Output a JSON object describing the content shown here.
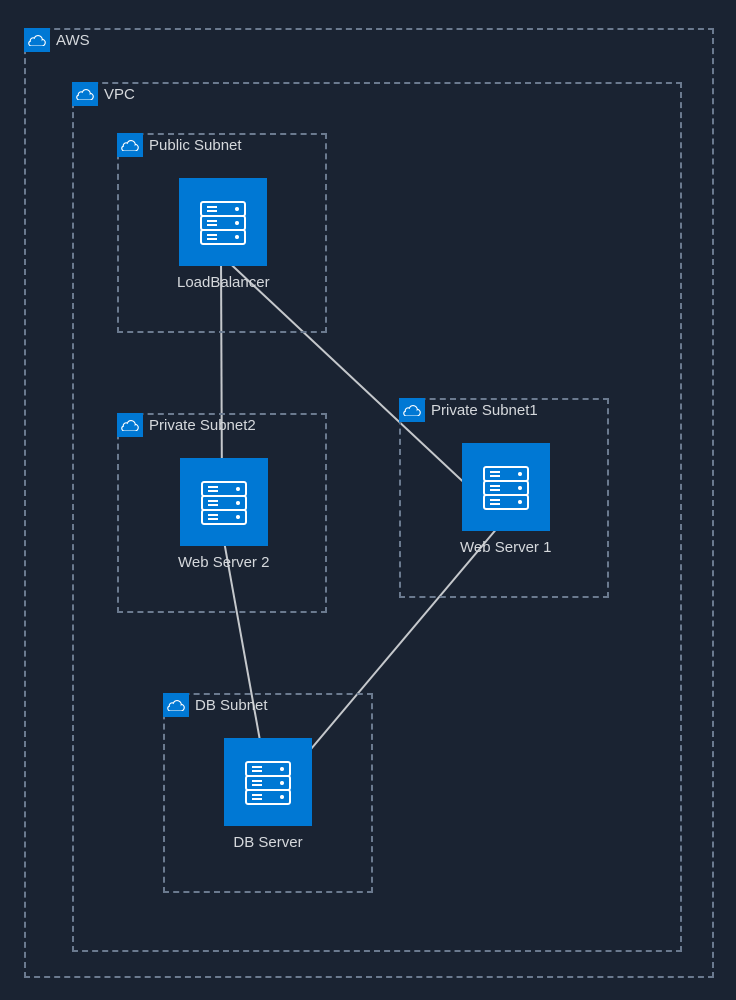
{
  "diagram": {
    "containers": {
      "aws": {
        "label": "AWS"
      },
      "vpc": {
        "label": "VPC"
      },
      "publicSubnet": {
        "label": "Public Subnet"
      },
      "privateSubnet1": {
        "label": "Private Subnet1"
      },
      "privateSubnet2": {
        "label": "Private Subnet2"
      },
      "dbSubnet": {
        "label": "DB Subnet"
      }
    },
    "nodes": {
      "loadBalancer": {
        "label": "LoadBalancer"
      },
      "webServer1": {
        "label": "Web Server 1"
      },
      "webServer2": {
        "label": "Web Server 2"
      },
      "dbServer": {
        "label": "DB Server"
      }
    },
    "connections": [
      {
        "from": "loadBalancer",
        "to": "webServer1"
      },
      {
        "from": "loadBalancer",
        "to": "webServer2"
      },
      {
        "from": "webServer1",
        "to": "dbServer"
      },
      {
        "from": "webServer2",
        "to": "dbServer"
      }
    ]
  }
}
